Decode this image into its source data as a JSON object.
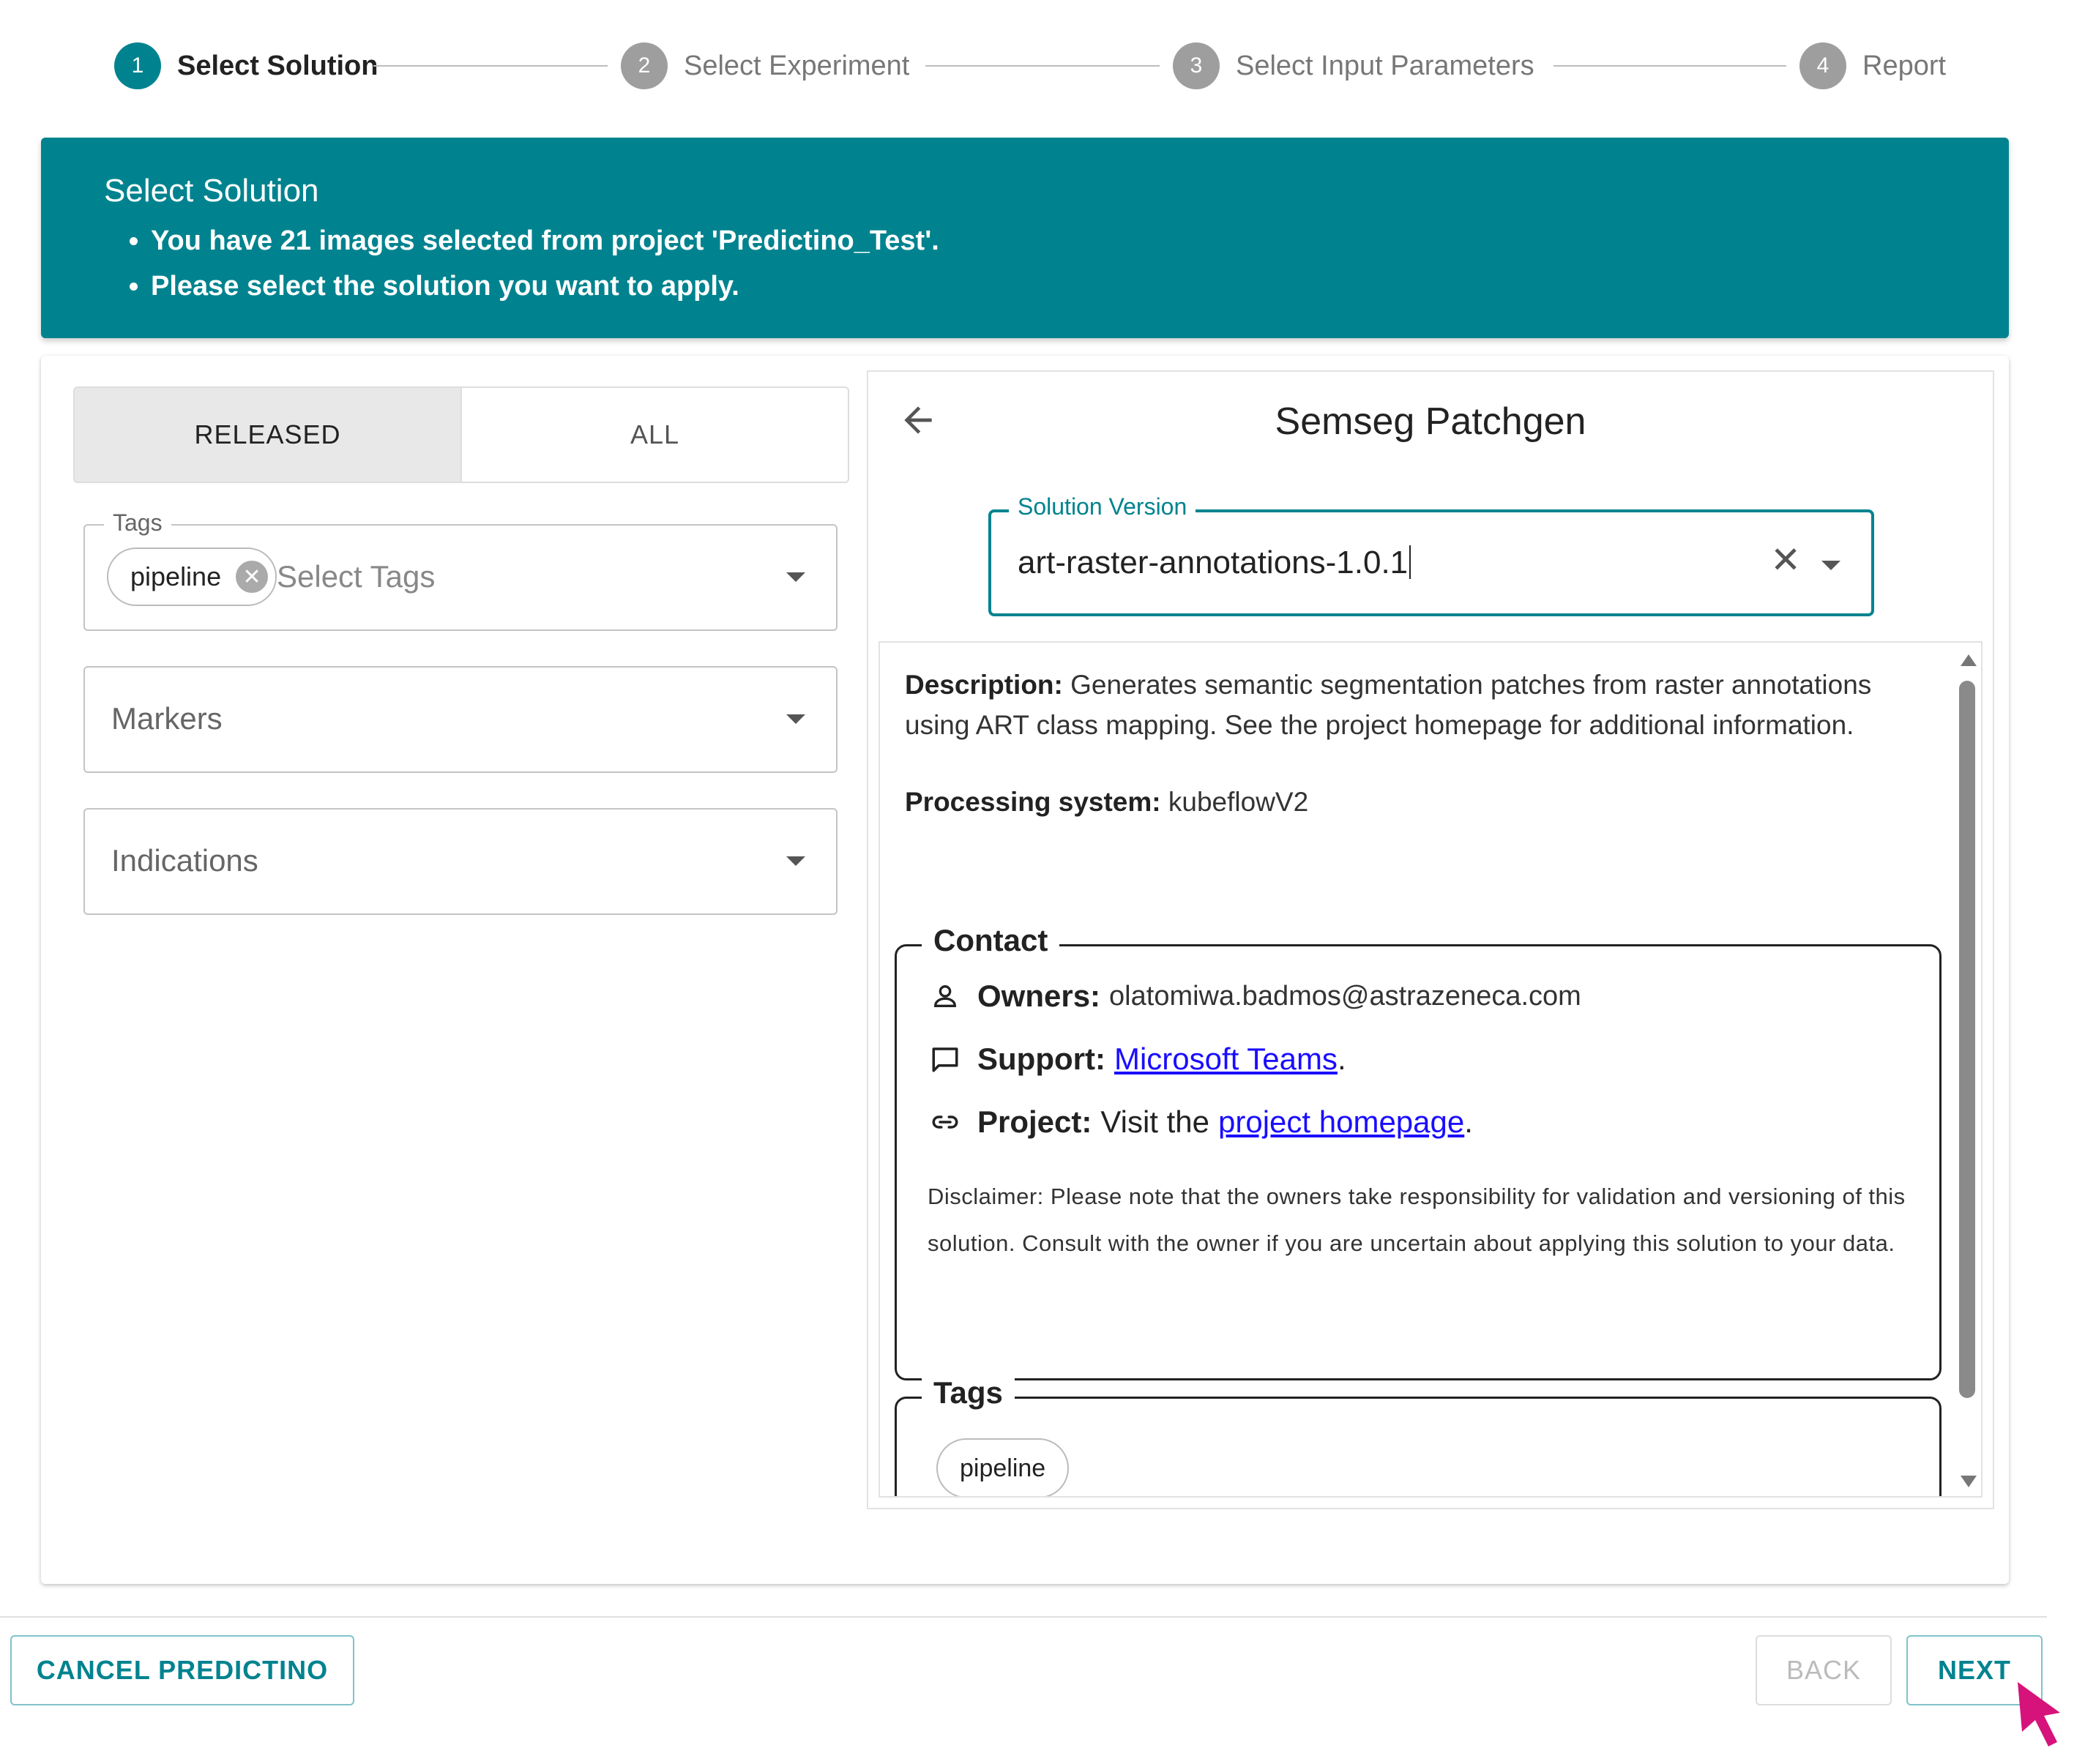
{
  "stepper": {
    "steps": [
      {
        "number": "1",
        "label": "Select Solution"
      },
      {
        "number": "2",
        "label": "Select Experiment"
      },
      {
        "number": "3",
        "label": "Select Input Parameters"
      },
      {
        "number": "4",
        "label": "Report"
      }
    ]
  },
  "banner": {
    "title": "Select Solution",
    "bullets": [
      "You have 21 images selected from project 'Predictino_Test'.",
      "Please select the solution you want to apply."
    ]
  },
  "filters": {
    "toggle": {
      "released": "RELEASED",
      "all": "ALL",
      "selected": "RELEASED"
    },
    "tags": {
      "legend": "Tags",
      "chip": "pipeline",
      "placeholder": "Select Tags"
    },
    "markers": {
      "placeholder": "Markers"
    },
    "indications": {
      "placeholder": "Indications"
    }
  },
  "detail": {
    "title": "Semseg Patchgen",
    "version": {
      "legend": "Solution Version",
      "value": "art-raster-annotations-1.0.1"
    },
    "description": {
      "label": "Description:",
      "text": "Generates semantic segmentation patches from raster annotations using ART class mapping. See the project homepage for additional information."
    },
    "processing": {
      "label": "Processing system:",
      "value": "kubeflowV2"
    },
    "contact": {
      "legend": "Contact",
      "owners_label": "Owners:",
      "owners_value": "olatomiwa.badmos@astrazeneca.com",
      "support_label": "Support:",
      "support_link": "Microsoft Teams",
      "project_label": "Project:",
      "project_prefix": "Visit the",
      "project_link": "project homepage",
      "disclaimer": "Disclaimer: Please note that the owners take responsibility for validation and versioning of this solution. Consult with the owner if you are uncertain about applying this solution to your data."
    },
    "tags": {
      "legend": "Tags",
      "items": [
        "pipeline"
      ]
    }
  },
  "footer": {
    "cancel": "CANCEL PREDICTINO",
    "back": "BACK",
    "next": "NEXT"
  },
  "colors": {
    "accent": "#00838f",
    "link": "#1a0dff",
    "cursor": "#d6137a"
  },
  "icons": [
    "person-icon",
    "chat-icon",
    "link-icon",
    "arrow-left-icon",
    "close-icon",
    "chevron-down-icon",
    "mouse-cursor-icon"
  ]
}
